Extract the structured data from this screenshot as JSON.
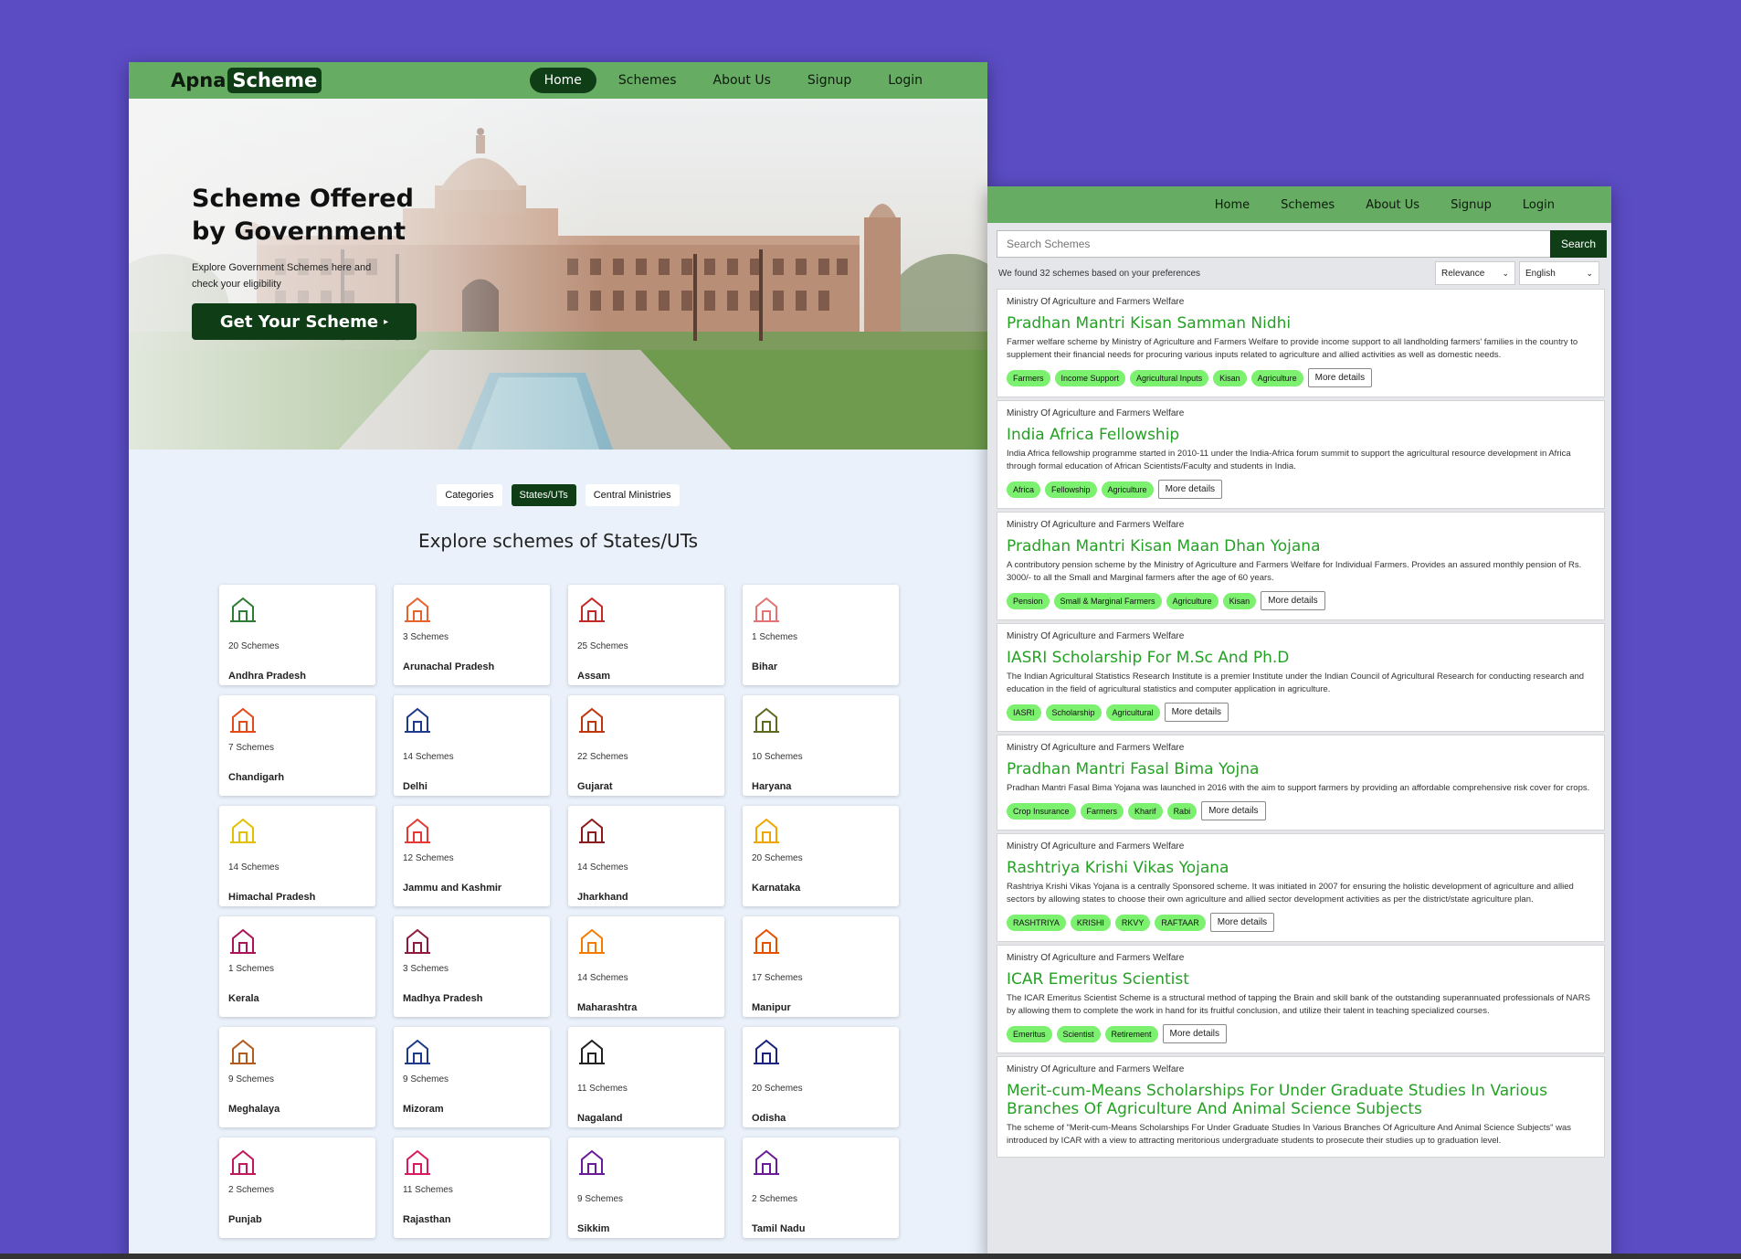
{
  "left": {
    "logo": {
      "part1": "Apna",
      "part2": "Scheme"
    },
    "nav": [
      "Home",
      "Schemes",
      "About Us",
      "Signup",
      "Login"
    ],
    "hero": {
      "title": "Scheme Offered by Government",
      "subtitle": "Explore Government Schemes here and check your eligibility",
      "cta": "Get Your Scheme"
    },
    "tabs": [
      "Categories",
      "States/UTs",
      "Central Ministries"
    ],
    "explore_title": "Explore schemes of States/UTs",
    "states": [
      {
        "count": "20 Schemes",
        "name": "Andhra Pradesh",
        "icon": "charminar-icon",
        "color": "#2e7d32"
      },
      {
        "count": "3 Schemes",
        "name": "Arunachal Pradesh",
        "icon": "monastery-icon",
        "color": "#e8632b"
      },
      {
        "count": "25 Schemes",
        "name": "Assam",
        "icon": "rhino-seal-icon",
        "color": "#c62828"
      },
      {
        "count": "1 Schemes",
        "name": "Bihar",
        "icon": "temple-icon",
        "color": "#e57373"
      },
      {
        "count": "7 Schemes",
        "name": "Chandigarh",
        "icon": "open-hand-icon",
        "color": "#e64a19"
      },
      {
        "count": "14 Schemes",
        "name": "Delhi",
        "icon": "india-gate-icon",
        "color": "#1e3a8a"
      },
      {
        "count": "22 Schemes",
        "name": "Gujarat",
        "icon": "stepwell-icon",
        "color": "#bf360c"
      },
      {
        "count": "10 Schemes",
        "name": "Haryana",
        "icon": "fort-icon",
        "color": "#5d6b1e"
      },
      {
        "count": "14 Schemes",
        "name": "Himachal Pradesh",
        "icon": "church-icon",
        "color": "#e0c000"
      },
      {
        "count": "12 Schemes",
        "name": "Jammu and Kashmir",
        "icon": "pagoda-icon",
        "color": "#e53935"
      },
      {
        "count": "14 Schemes",
        "name": "Jharkhand",
        "icon": "palace-icon",
        "color": "#8e1b1b"
      },
      {
        "count": "20 Schemes",
        "name": "Karnataka",
        "icon": "mysore-palace-icon",
        "color": "#f0a500"
      },
      {
        "count": "1 Schemes",
        "name": "Kerala",
        "icon": "houseboat-icon",
        "color": "#ad1457"
      },
      {
        "count": "3 Schemes",
        "name": "Madhya Pradesh",
        "icon": "stupa-icon",
        "color": "#8e1b3b"
      },
      {
        "count": "14 Schemes",
        "name": "Maharashtra",
        "icon": "gateway-icon",
        "color": "#f57c00"
      },
      {
        "count": "17 Schemes",
        "name": "Manipur",
        "icon": "shrine-icon",
        "color": "#e65100"
      },
      {
        "count": "9 Schemes",
        "name": "Meghalaya",
        "icon": "leopard-icon",
        "color": "#b35a1f"
      },
      {
        "count": "9 Schemes",
        "name": "Mizoram",
        "icon": "bamboo-icon",
        "color": "#1e3a8a"
      },
      {
        "count": "11 Schemes",
        "name": "Nagaland",
        "icon": "mithun-icon",
        "color": "#222222"
      },
      {
        "count": "20 Schemes",
        "name": "Odisha",
        "icon": "konark-icon",
        "color": "#1a237e"
      },
      {
        "count": "2 Schemes",
        "name": "Punjab",
        "icon": "golden-temple-icon",
        "color": "#c2185b"
      },
      {
        "count": "11 Schemes",
        "name": "Rajasthan",
        "icon": "hawa-mahal-icon",
        "color": "#d81b60"
      },
      {
        "count": "9 Schemes",
        "name": "Sikkim",
        "icon": "monastery-icon",
        "color": "#6a1b9a"
      },
      {
        "count": "2 Schemes",
        "name": "Tamil Nadu",
        "icon": "gopuram-icon",
        "color": "#6a1b9a"
      }
    ]
  },
  "right": {
    "nav": [
      "Home",
      "Schemes",
      "About Us",
      "Signup",
      "Login"
    ],
    "search": {
      "placeholder": "Search Schemes",
      "button": "Search"
    },
    "found_text": "We found 32 schemes based on your preferences",
    "sort_value": "Relevance",
    "language_value": "English",
    "more_label": "More details",
    "schemes": [
      {
        "ministry": "Ministry Of Agriculture and Farmers Welfare",
        "title": "Pradhan Mantri Kisan Samman Nidhi",
        "desc": "Farmer welfare scheme by Ministry of Agriculture and Farmers Welfare to provide income support to all landholding farmers' families in the country to supplement their financial needs for procuring various inputs related to agriculture and allied activities as well as domestic needs.",
        "tags": [
          "Farmers",
          "Income Support",
          "Agricultural Inputs",
          "Kisan",
          "Agriculture"
        ]
      },
      {
        "ministry": "Ministry Of Agriculture and Farmers Welfare",
        "title": "India Africa Fellowship",
        "desc": "India Africa fellowship programme started in 2010-11 under the India-Africa forum summit to support the agricultural resource development in Africa through formal education of African Scientists/Faculty and students in India.",
        "tags": [
          "Africa",
          "Fellowship",
          "Agriculture"
        ]
      },
      {
        "ministry": "Ministry Of Agriculture and Farmers Welfare",
        "title": "Pradhan Mantri Kisan Maan Dhan Yojana",
        "desc": "A contributory pension scheme by the Ministry of Agriculture and Farmers Welfare for Individual Farmers. Provides an assured monthly pension of Rs. 3000/- to all the Small and Marginal farmers after the age of 60 years.",
        "tags": [
          "Pension",
          "Small & Marginal Farmers",
          "Agriculture",
          "Kisan"
        ]
      },
      {
        "ministry": "Ministry Of Agriculture and Farmers Welfare",
        "title": "IASRI Scholarship For M.Sc And Ph.D",
        "desc": "The Indian Agricultural Statistics Research Institute is a premier Institute under the Indian Council of Agricultural Research for conducting research and education in the field of agricultural statistics and computer application in agriculture.",
        "tags": [
          "IASRI",
          "Scholarship",
          "Agricultural"
        ]
      },
      {
        "ministry": "Ministry Of Agriculture and Farmers Welfare",
        "title": "Pradhan Mantri Fasal Bima Yojna",
        "desc": "Pradhan Mantri Fasal Bima Yojana was launched in 2016 with the aim to support farmers by providing an affordable comprehensive risk cover for crops.",
        "tags": [
          "Crop Insurance",
          "Farmers",
          "Kharif",
          "Rabi"
        ]
      },
      {
        "ministry": "Ministry Of Agriculture and Farmers Welfare",
        "title": "Rashtriya Krishi Vikas Yojana",
        "desc": "Rashtriya Krishi Vikas Yojana is a centrally Sponsored scheme. It was initiated in 2007 for ensuring the holistic development of agriculture and allied sectors by allowing states to choose their own agriculture and allied sector development activities as per the district/state agriculture plan.",
        "tags": [
          "RASHTRIYA",
          "KRISHI",
          "RKVY",
          "RAFTAAR"
        ]
      },
      {
        "ministry": "Ministry Of Agriculture and Farmers Welfare",
        "title": "ICAR Emeritus Scientist",
        "desc": "The ICAR Emeritus Scientist Scheme is a structural method of tapping the Brain and skill bank of the outstanding superannuated professionals of NARS by allowing them to complete the work in hand for its fruitful conclusion, and utilize their talent in teaching specialized courses.",
        "tags": [
          "Emeritus",
          "Scientist",
          "Retirement"
        ]
      },
      {
        "ministry": "Ministry Of Agriculture and Farmers Welfare",
        "title": "Merit-cum-Means Scholarships For Under Graduate Studies In Various Branches Of Agriculture And Animal Science Subjects",
        "desc": "The scheme of \"Merit-cum-Means Scholarships For Under Graduate Studies In Various Branches Of Agriculture And Animal Science Subjects\" was introduced by ICAR with a view to attracting meritorious undergraduate students to prosecute their studies up to graduation level.",
        "tags": []
      }
    ]
  }
}
